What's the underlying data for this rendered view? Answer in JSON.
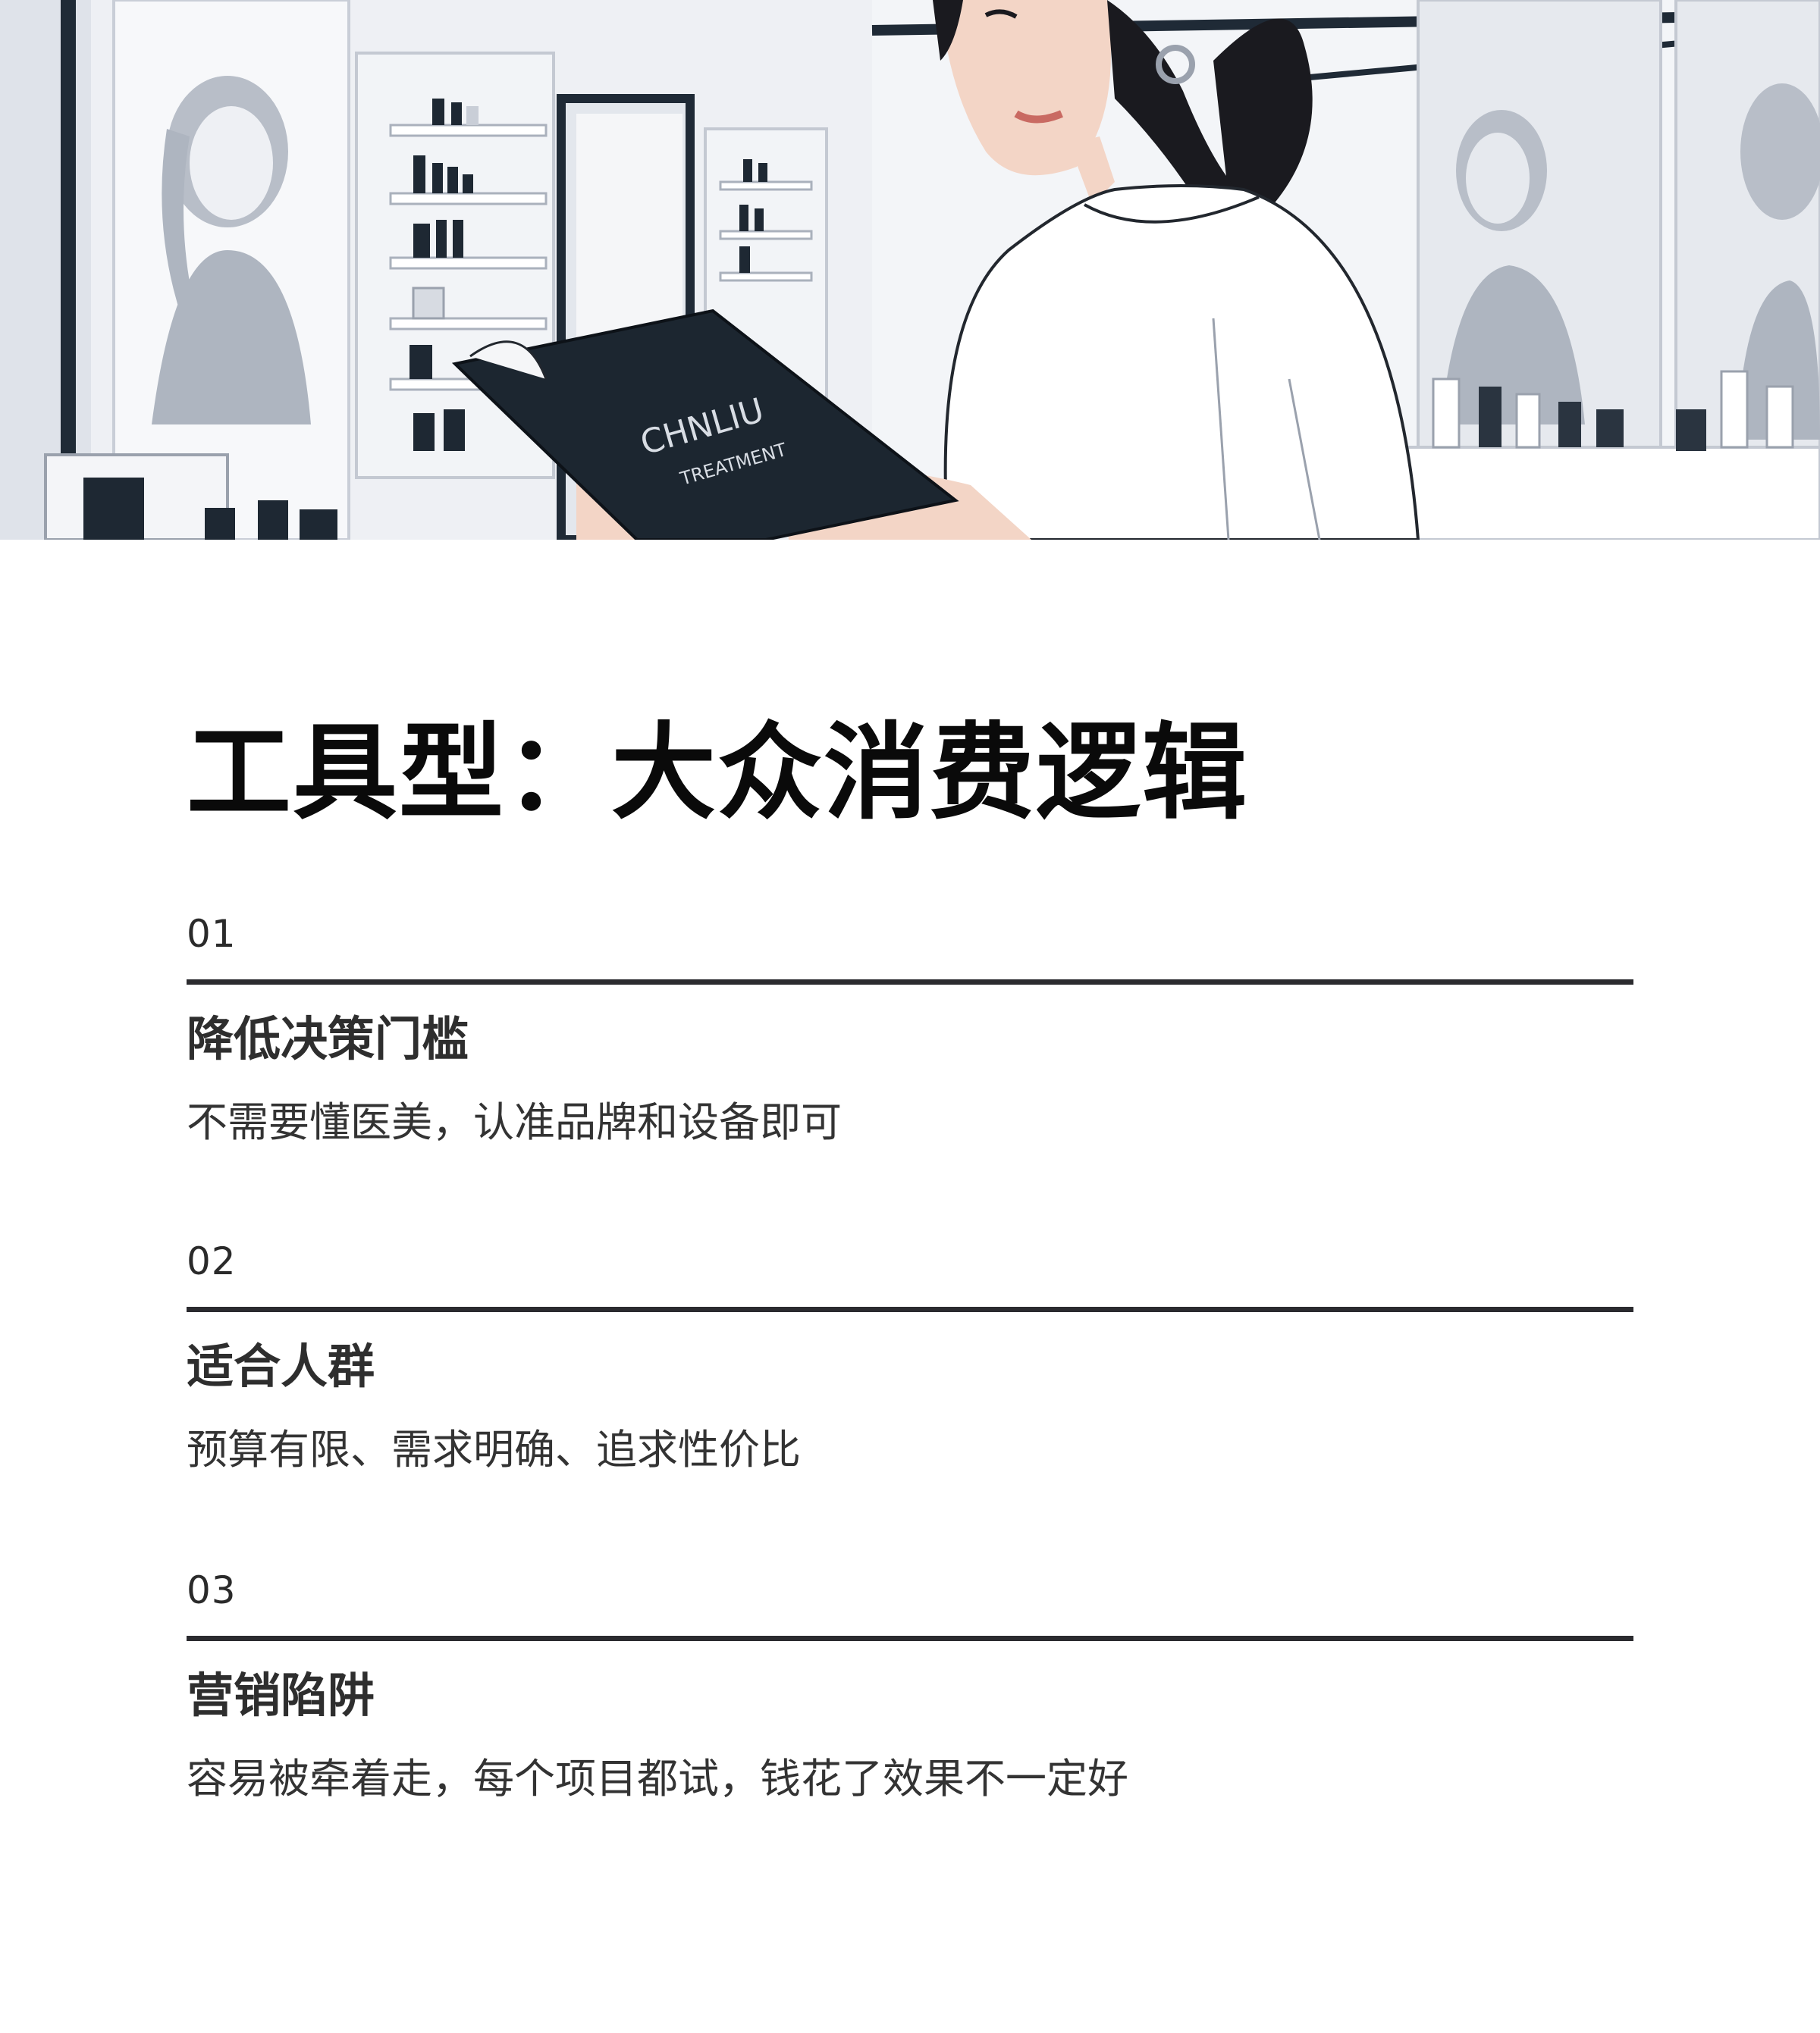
{
  "hero": {
    "book_title": "CHNLIU",
    "book_subtitle": "TREATMENT"
  },
  "page_title": "工具型：大众消费逻辑",
  "sections": [
    {
      "number": "01",
      "heading": "降低决策门槛",
      "description": "不需要懂医美，认准品牌和设备即可"
    },
    {
      "number": "02",
      "heading": "适合人群",
      "description": "预算有限、需求明确、追求性价比"
    },
    {
      "number": "03",
      "heading": "营销陷阱",
      "description": "容易被牵着走，每个项目都试，钱花了效果不一定好"
    }
  ],
  "colors": {
    "rule": "#2b2b2f",
    "title": "#0a0a0a",
    "text": "#333333",
    "book": "#1c2630"
  }
}
